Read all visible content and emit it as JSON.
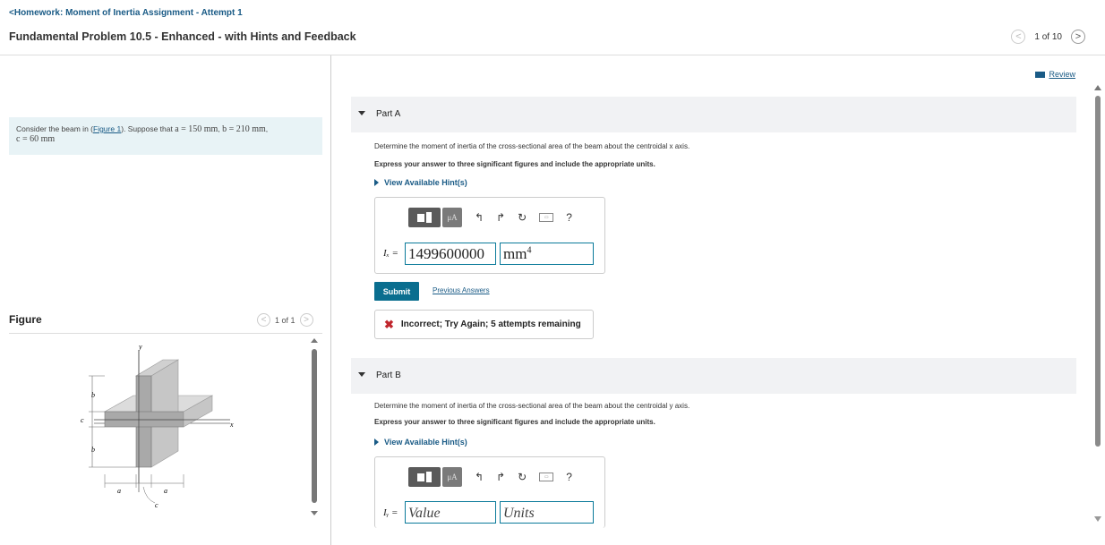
{
  "header": {
    "breadcrumb": "Homework: Moment of Inertia Assignment - Attempt 1",
    "breadcrumb_arrow": "<",
    "title": "Fundamental Problem 10.5 - Enhanced - with Hints and Feedback",
    "pager": {
      "label": "1 of 10",
      "prev": "<",
      "next": ">"
    }
  },
  "review": {
    "label": "Review"
  },
  "problem": {
    "t1": "Consider the beam in (",
    "link": "Figure 1",
    "t2": "). Suppose that ",
    "a": "a = 150 mm",
    "sep1": ", ",
    "b": "b = 210 mm",
    "sep2": ",",
    "c": "c = 60 mm"
  },
  "figure": {
    "label": "Figure",
    "pager": {
      "label": "1 of 1",
      "prev": "<",
      "next": ">"
    },
    "labels": {
      "y": "y",
      "x": "x",
      "b": "b",
      "c": "c",
      "a": "a"
    }
  },
  "partA": {
    "title": "Part A",
    "question": "Determine the moment of inertia of the cross-sectional area of the beam about the centroidal x axis.",
    "instruction": "Express your answer to three significant figures and include the appropriate units.",
    "hint": "View Available Hint(s)",
    "toolbar": {
      "mu": "μA",
      "help": "?"
    },
    "label": "Iₓ =",
    "value": "1499600000",
    "unit": "mm",
    "unit_exp": "4",
    "submit": "Submit",
    "previous": "Previous Answers",
    "feedback_icon": "✖",
    "feedback": "Incorrect; Try Again; 5 attempts remaining"
  },
  "partB": {
    "title": "Part B",
    "question": "Determine the moment of inertia of the cross-sectional area of the beam about the centroidal y axis.",
    "instruction": "Express your answer to three significant figures and include the appropriate units.",
    "hint": "View Available Hint(s)",
    "toolbar": {
      "mu": "μA",
      "help": "?"
    },
    "label": "Iᵧ =",
    "value_placeholder": "Value",
    "unit_placeholder": "Units"
  },
  "colors": {
    "accent": "#1a5b86",
    "submit": "#0a6e8f",
    "error": "#c0262d",
    "problem_bg": "#e8f3f6"
  }
}
